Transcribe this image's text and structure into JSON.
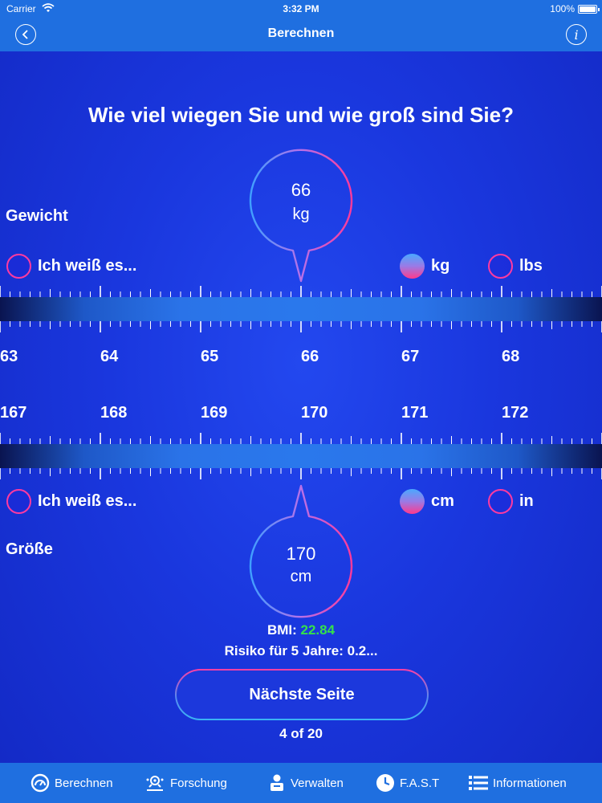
{
  "status": {
    "carrier": "Carrier",
    "time": "3:32 PM",
    "battery": "100%"
  },
  "nav": {
    "title": "Berechnen"
  },
  "question": "Wie viel wiegen Sie und wie groß sind Sie?",
  "weight": {
    "label": "Gewicht",
    "value": "66",
    "unit": "kg",
    "unknown_label": "Ich weiß es...",
    "unit_options": [
      {
        "label": "kg",
        "selected": true
      },
      {
        "label": "lbs",
        "selected": false
      }
    ],
    "ticks": [
      "63",
      "64",
      "65",
      "66",
      "67",
      "68"
    ]
  },
  "height": {
    "label": "Größe",
    "value": "170",
    "unit": "cm",
    "unknown_label": "Ich weiß es...",
    "unit_options": [
      {
        "label": "cm",
        "selected": true
      },
      {
        "label": "in",
        "selected": false
      }
    ],
    "ticks": [
      "167",
      "168",
      "169",
      "170",
      "171",
      "172"
    ]
  },
  "bmi": {
    "label": "BMI:",
    "value": "22.84",
    "value_color": "#35e04c"
  },
  "risk": {
    "text": "Risiko für 5 Jahre: 0.2..."
  },
  "next_button": {
    "label": "Nächste Seite"
  },
  "page_indicator": "4 of 20",
  "tabs": [
    {
      "label": "Berechnen",
      "icon": "gauge-icon"
    },
    {
      "label": "Forschung",
      "icon": "research-icon"
    },
    {
      "label": "Verwalten",
      "icon": "manage-icon"
    },
    {
      "label": "F.A.S.T",
      "icon": "clock-icon"
    },
    {
      "label": "Informationen",
      "icon": "list-icon"
    }
  ]
}
